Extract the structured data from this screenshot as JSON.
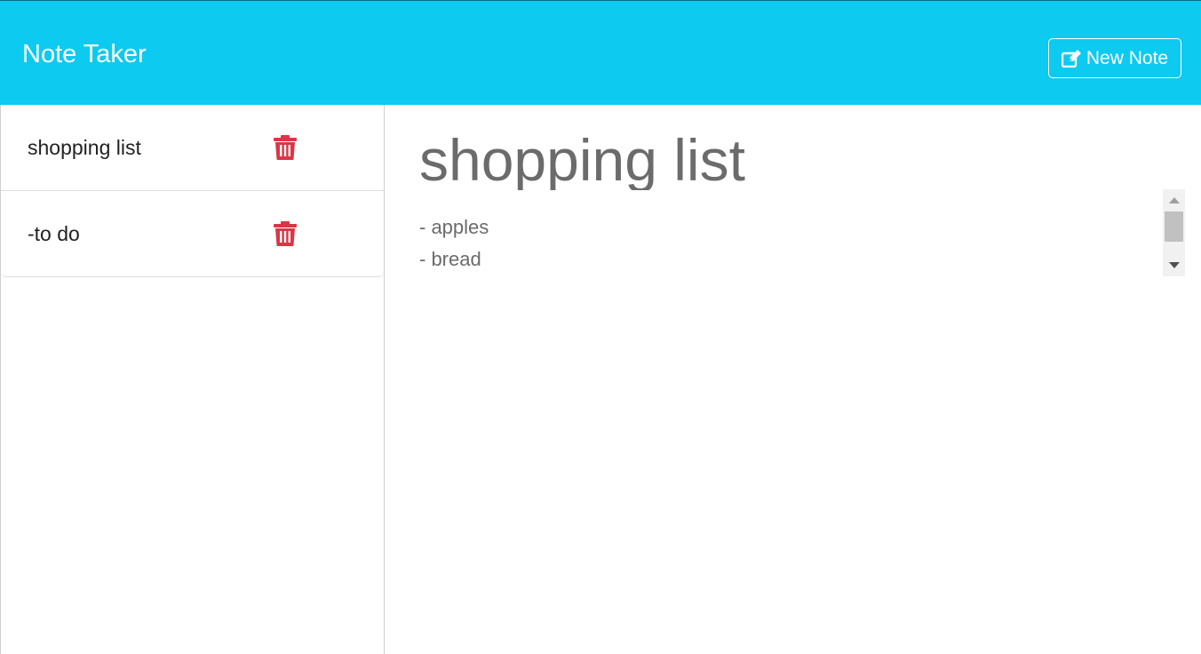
{
  "header": {
    "title": "Note Taker",
    "new_note_label": "New Note",
    "new_note_icon": "edit-icon"
  },
  "sidebar": {
    "notes": [
      {
        "title": "shopping list",
        "delete_icon": "trash-icon"
      },
      {
        "title": "-to do",
        "delete_icon": "trash-icon"
      }
    ]
  },
  "editor": {
    "title": "shopping list",
    "body_lines": [
      "- apples",
      "- bread"
    ]
  },
  "colors": {
    "navbar": "#0dcaf0",
    "delete": "#dc3545",
    "text_muted": "#6b6b6b"
  }
}
